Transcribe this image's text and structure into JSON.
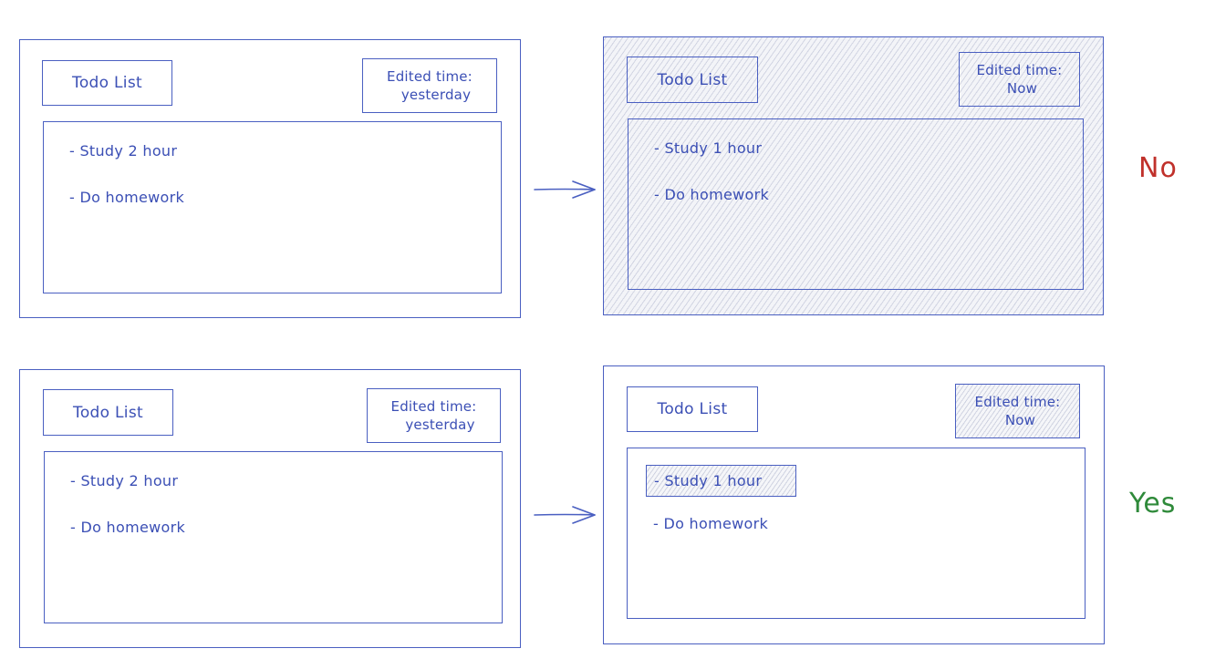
{
  "panels": {
    "top_before": {
      "title": "Todo List",
      "time_label": "Edited time:",
      "time_value": "yesterday",
      "items": [
        "- Study 2 hour",
        "- Do homework"
      ]
    },
    "top_after": {
      "title": "Todo List",
      "time_label": "Edited time:",
      "time_value": "Now",
      "items": [
        "- Study 1 hour",
        "- Do homework"
      ]
    },
    "bottom_before": {
      "title": "Todo List",
      "time_label": "Edited time:",
      "time_value": "yesterday",
      "items": [
        "- Study 2 hour",
        "- Do homework"
      ]
    },
    "bottom_after": {
      "title": "Todo List",
      "time_label": "Edited time:",
      "time_value": "Now",
      "items": [
        "- Study 1 hour",
        "- Do homework"
      ]
    }
  },
  "verdicts": {
    "top": "No",
    "bottom": "Yes"
  },
  "colors": {
    "stroke": "#4a5fc1",
    "text": "#3b4fb5",
    "no": "#c0312b",
    "yes": "#2f8a3a"
  }
}
